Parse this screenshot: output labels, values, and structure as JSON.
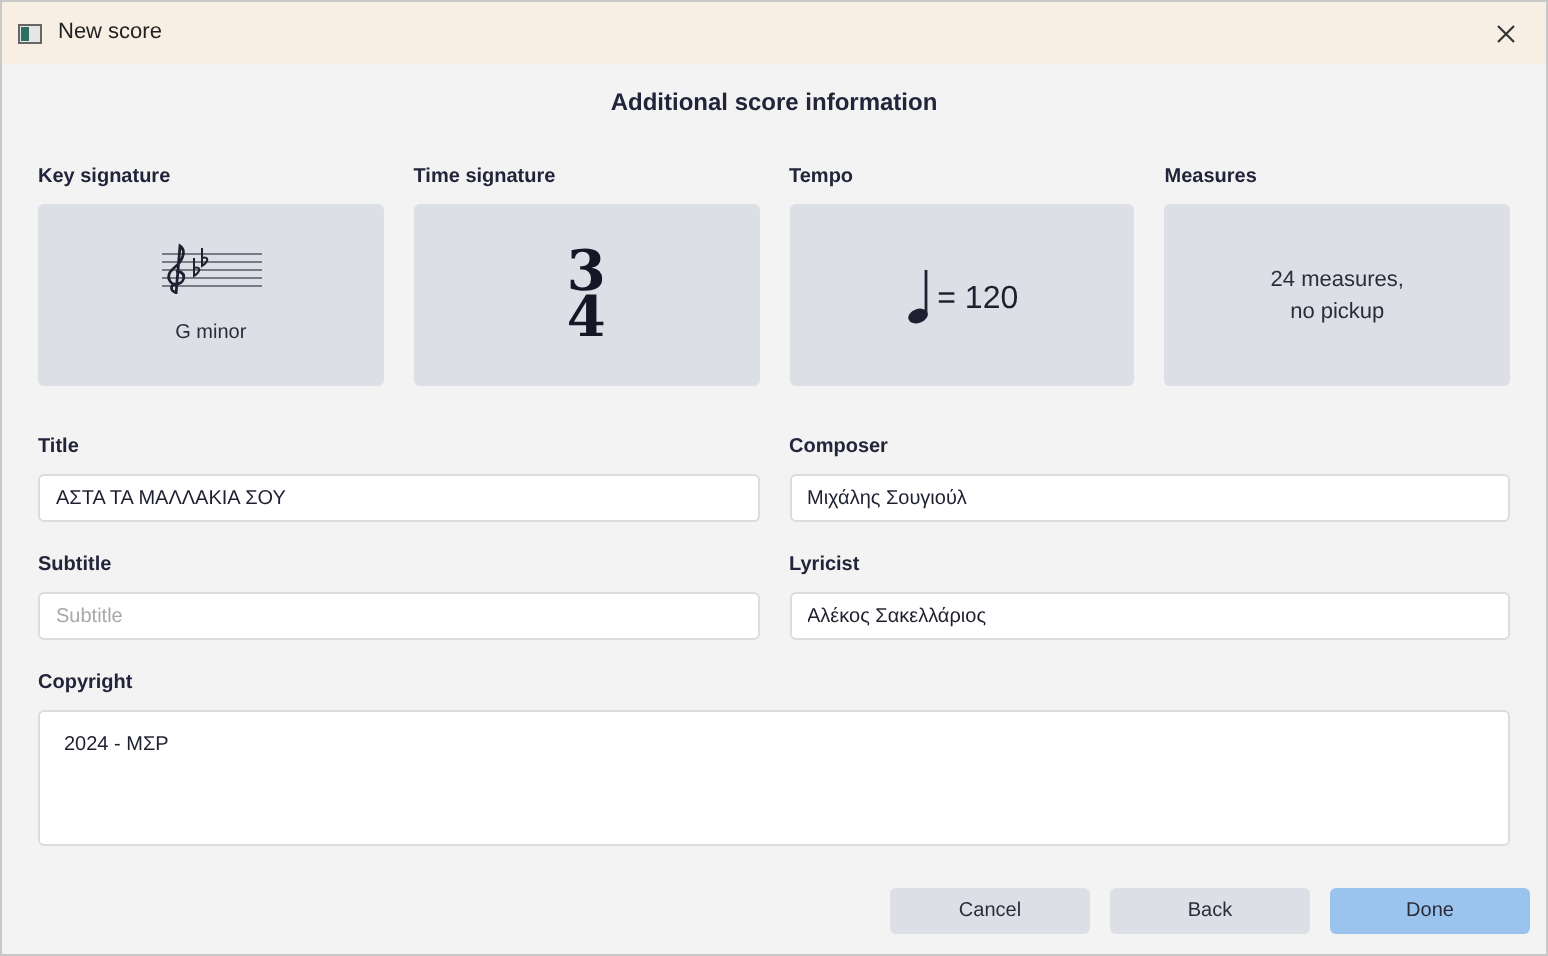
{
  "window": {
    "title": "New score"
  },
  "heading": "Additional score information",
  "cards": [
    {
      "kind": "key",
      "label": "Key signature",
      "text": "G minor"
    },
    {
      "kind": "time",
      "label": "Time signature",
      "numerator": "3",
      "denominator": "4"
    },
    {
      "kind": "tempo",
      "label": "Tempo",
      "text": "= 120"
    },
    {
      "kind": "measures",
      "label": "Measures",
      "lines": [
        "24 measures,",
        "no pickup"
      ]
    }
  ],
  "fields": [
    {
      "label": "Title",
      "value": "ΑΣΤΑ ΤΑ ΜΑΛΛΑΚΙΑ ΣΟΥ"
    },
    {
      "label": "Composer",
      "value": "Μιχάλης Σουγιούλ"
    },
    {
      "label": "Subtitle",
      "placeholder": "Subtitle"
    },
    {
      "label": "Lyricist",
      "value": "Αλέκος Σακελλάριος"
    }
  ],
  "copyright": {
    "label": "Copyright",
    "value": "2024 - ΜΣΡ"
  },
  "buttons": [
    {
      "label": "Cancel",
      "primary": false
    },
    {
      "label": "Back",
      "primary": false
    },
    {
      "label": "Done",
      "primary": true
    }
  ]
}
